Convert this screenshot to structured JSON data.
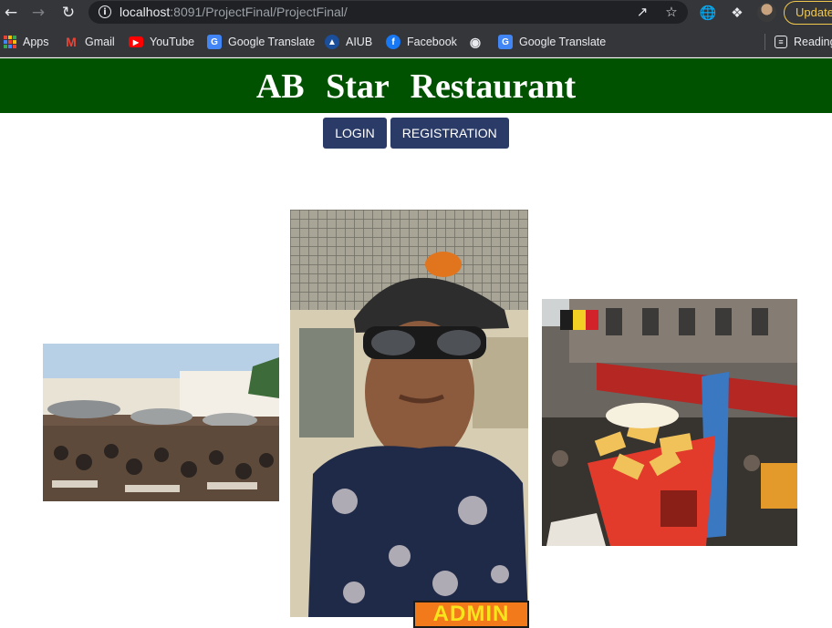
{
  "browser": {
    "url_host": "localhost",
    "url_path": ":8091/ProjectFinal/ProjectFinal/",
    "update_label": "Update"
  },
  "bookmarks": [
    {
      "label": "Apps",
      "icon": "apps-grid-icon"
    },
    {
      "label": "Gmail",
      "icon": "gmail-icon"
    },
    {
      "label": "YouTube",
      "icon": "youtube-icon"
    },
    {
      "label": "Google Translate",
      "icon": "google-translate-icon"
    },
    {
      "label": "AIUB",
      "icon": "aiub-icon"
    },
    {
      "label": "Facebook",
      "icon": "facebook-icon"
    },
    {
      "label": "",
      "icon": "globe-icon"
    },
    {
      "label": "Google Translate",
      "icon": "google-translate-icon"
    },
    {
      "label": "Reading",
      "icon": "reading-list-icon"
    }
  ],
  "site": {
    "title": "AB Star Restaurant",
    "login_label": "LOGIN",
    "registration_label": "REGISTRATION",
    "admin_label": "ADMIN"
  },
  "colors": {
    "header_green": "#005200",
    "button_navy": "#2a3b67",
    "admin_orange": "#f27a1a",
    "admin_text_yellow": "#f7e51c"
  }
}
